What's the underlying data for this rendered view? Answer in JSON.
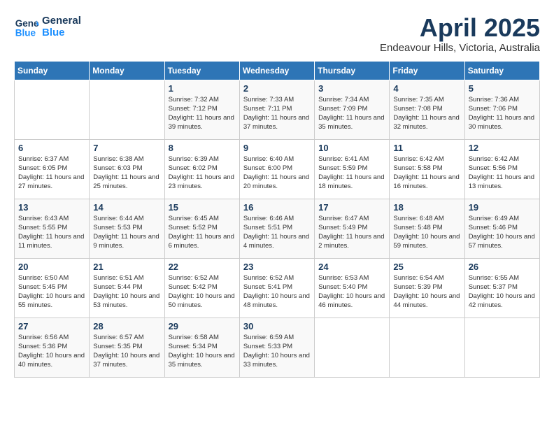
{
  "header": {
    "logo_line1": "General",
    "logo_line2": "Blue",
    "title": "April 2025",
    "subtitle": "Endeavour Hills, Victoria, Australia"
  },
  "days_of_week": [
    "Sunday",
    "Monday",
    "Tuesday",
    "Wednesday",
    "Thursday",
    "Friday",
    "Saturday"
  ],
  "weeks": [
    [
      {
        "day": "",
        "info": ""
      },
      {
        "day": "",
        "info": ""
      },
      {
        "day": "1",
        "info": "Sunrise: 7:32 AM\nSunset: 7:12 PM\nDaylight: 11 hours and 39 minutes."
      },
      {
        "day": "2",
        "info": "Sunrise: 7:33 AM\nSunset: 7:11 PM\nDaylight: 11 hours and 37 minutes."
      },
      {
        "day": "3",
        "info": "Sunrise: 7:34 AM\nSunset: 7:09 PM\nDaylight: 11 hours and 35 minutes."
      },
      {
        "day": "4",
        "info": "Sunrise: 7:35 AM\nSunset: 7:08 PM\nDaylight: 11 hours and 32 minutes."
      },
      {
        "day": "5",
        "info": "Sunrise: 7:36 AM\nSunset: 7:06 PM\nDaylight: 11 hours and 30 minutes."
      }
    ],
    [
      {
        "day": "6",
        "info": "Sunrise: 6:37 AM\nSunset: 6:05 PM\nDaylight: 11 hours and 27 minutes."
      },
      {
        "day": "7",
        "info": "Sunrise: 6:38 AM\nSunset: 6:03 PM\nDaylight: 11 hours and 25 minutes."
      },
      {
        "day": "8",
        "info": "Sunrise: 6:39 AM\nSunset: 6:02 PM\nDaylight: 11 hours and 23 minutes."
      },
      {
        "day": "9",
        "info": "Sunrise: 6:40 AM\nSunset: 6:00 PM\nDaylight: 11 hours and 20 minutes."
      },
      {
        "day": "10",
        "info": "Sunrise: 6:41 AM\nSunset: 5:59 PM\nDaylight: 11 hours and 18 minutes."
      },
      {
        "day": "11",
        "info": "Sunrise: 6:42 AM\nSunset: 5:58 PM\nDaylight: 11 hours and 16 minutes."
      },
      {
        "day": "12",
        "info": "Sunrise: 6:42 AM\nSunset: 5:56 PM\nDaylight: 11 hours and 13 minutes."
      }
    ],
    [
      {
        "day": "13",
        "info": "Sunrise: 6:43 AM\nSunset: 5:55 PM\nDaylight: 11 hours and 11 minutes."
      },
      {
        "day": "14",
        "info": "Sunrise: 6:44 AM\nSunset: 5:53 PM\nDaylight: 11 hours and 9 minutes."
      },
      {
        "day": "15",
        "info": "Sunrise: 6:45 AM\nSunset: 5:52 PM\nDaylight: 11 hours and 6 minutes."
      },
      {
        "day": "16",
        "info": "Sunrise: 6:46 AM\nSunset: 5:51 PM\nDaylight: 11 hours and 4 minutes."
      },
      {
        "day": "17",
        "info": "Sunrise: 6:47 AM\nSunset: 5:49 PM\nDaylight: 11 hours and 2 minutes."
      },
      {
        "day": "18",
        "info": "Sunrise: 6:48 AM\nSunset: 5:48 PM\nDaylight: 10 hours and 59 minutes."
      },
      {
        "day": "19",
        "info": "Sunrise: 6:49 AM\nSunset: 5:46 PM\nDaylight: 10 hours and 57 minutes."
      }
    ],
    [
      {
        "day": "20",
        "info": "Sunrise: 6:50 AM\nSunset: 5:45 PM\nDaylight: 10 hours and 55 minutes."
      },
      {
        "day": "21",
        "info": "Sunrise: 6:51 AM\nSunset: 5:44 PM\nDaylight: 10 hours and 53 minutes."
      },
      {
        "day": "22",
        "info": "Sunrise: 6:52 AM\nSunset: 5:42 PM\nDaylight: 10 hours and 50 minutes."
      },
      {
        "day": "23",
        "info": "Sunrise: 6:52 AM\nSunset: 5:41 PM\nDaylight: 10 hours and 48 minutes."
      },
      {
        "day": "24",
        "info": "Sunrise: 6:53 AM\nSunset: 5:40 PM\nDaylight: 10 hours and 46 minutes."
      },
      {
        "day": "25",
        "info": "Sunrise: 6:54 AM\nSunset: 5:39 PM\nDaylight: 10 hours and 44 minutes."
      },
      {
        "day": "26",
        "info": "Sunrise: 6:55 AM\nSunset: 5:37 PM\nDaylight: 10 hours and 42 minutes."
      }
    ],
    [
      {
        "day": "27",
        "info": "Sunrise: 6:56 AM\nSunset: 5:36 PM\nDaylight: 10 hours and 40 minutes."
      },
      {
        "day": "28",
        "info": "Sunrise: 6:57 AM\nSunset: 5:35 PM\nDaylight: 10 hours and 37 minutes."
      },
      {
        "day": "29",
        "info": "Sunrise: 6:58 AM\nSunset: 5:34 PM\nDaylight: 10 hours and 35 minutes."
      },
      {
        "day": "30",
        "info": "Sunrise: 6:59 AM\nSunset: 5:33 PM\nDaylight: 10 hours and 33 minutes."
      },
      {
        "day": "",
        "info": ""
      },
      {
        "day": "",
        "info": ""
      },
      {
        "day": "",
        "info": ""
      }
    ]
  ]
}
